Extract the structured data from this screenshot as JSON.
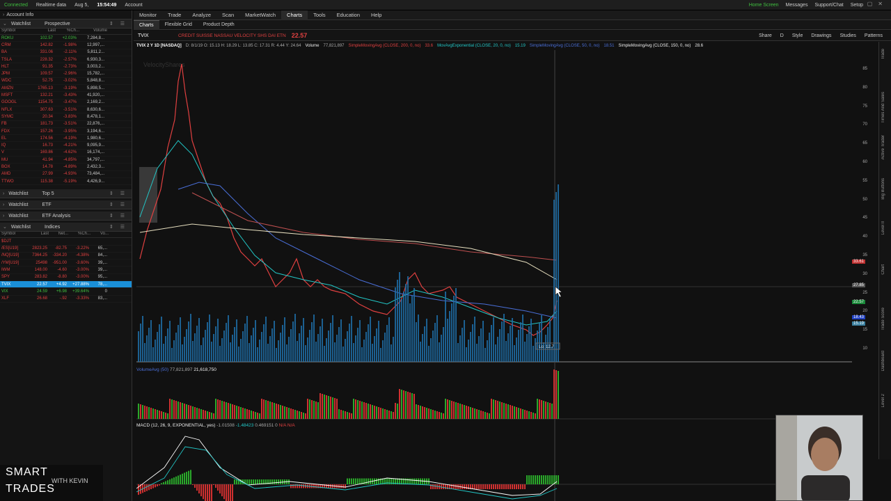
{
  "titlebar": {
    "status": "Connected",
    "realtime": "Realtime data",
    "date": "Aug 5,",
    "time": "15:54:49",
    "account": "Account",
    "home": "Home Screen",
    "messages": "Messages",
    "support": "Support/Chat",
    "setup": "Setup"
  },
  "left": {
    "account_info": "Account Info",
    "watchlist1": {
      "label": "Watchlist",
      "name": "Prospective",
      "cols": [
        "Symbol",
        "Last",
        "%Ch...",
        "Volume"
      ],
      "rows": [
        {
          "sym": "ROKU",
          "last": "102.57",
          "chg": "+2.03%",
          "vol": "7,284,8...",
          "up": true
        },
        {
          "sym": "CRM",
          "last": "142.82",
          "chg": "-1.98%",
          "vol": "12,997,..."
        },
        {
          "sym": "BA",
          "last": "331.06",
          "chg": "-2.11%",
          "vol": "5,811,2..."
        },
        {
          "sym": "TSLA",
          "last": "228.32",
          "chg": "-2.57%",
          "vol": "6,930,3..."
        },
        {
          "sym": "HLT",
          "last": "91.35",
          "chg": "-2.73%",
          "vol": "3,003,2..."
        },
        {
          "sym": "JPM",
          "last": "109.57",
          "chg": "-2.96%",
          "vol": "15,782,..."
        },
        {
          "sym": "WDC",
          "last": "52.75",
          "chg": "-3.02%",
          "vol": "5,848,8..."
        },
        {
          "sym": "AMZN",
          "last": "1765.13",
          "chg": "-3.19%",
          "vol": "5,898,5..."
        },
        {
          "sym": "MSFT",
          "last": "132.21",
          "chg": "-3.43%",
          "vol": "41,920,..."
        },
        {
          "sym": "GOOGL",
          "last": "1154.75",
          "chg": "-3.47%",
          "vol": "2,169,2..."
        },
        {
          "sym": "NFLX",
          "last": "307.63",
          "chg": "-3.51%",
          "vol": "8,630,6..."
        },
        {
          "sym": "SYMC",
          "last": "20.34",
          "chg": "-3.83%",
          "vol": "8,478,1..."
        },
        {
          "sym": "FB",
          "last": "181.73",
          "chg": "-3.51%",
          "vol": "22,876,..."
        },
        {
          "sym": "FDX",
          "last": "157.26",
          "chg": "-3.95%",
          "vol": "3,194,6..."
        },
        {
          "sym": "EL",
          "last": "174.56",
          "chg": "-4.19%",
          "vol": "1,980,6..."
        },
        {
          "sym": "IQ",
          "last": "16.73",
          "chg": "-4.21%",
          "vol": "9,095,9..."
        },
        {
          "sym": "V",
          "last": "169.86",
          "chg": "-4.62%",
          "vol": "16,174,..."
        },
        {
          "sym": "MU",
          "last": "41.94",
          "chg": "-4.85%",
          "vol": "34,797,..."
        },
        {
          "sym": "BOX",
          "last": "14.78",
          "chg": "-4.89%",
          "vol": "2,432,3..."
        },
        {
          "sym": "AMD",
          "last": "27.99",
          "chg": "-4.93%",
          "vol": "73,484,..."
        },
        {
          "sym": "TTWO",
          "last": "115.38",
          "chg": "-5.19%",
          "vol": "4,426,9..."
        }
      ]
    },
    "watchlist2": {
      "label": "Watchlist",
      "name": "Top 5"
    },
    "watchlist3": {
      "label": "Watchlist",
      "name": "ETF"
    },
    "watchlist4": {
      "label": "Watchlist",
      "name": "ETF Analysis"
    },
    "watchlist5": {
      "label": "Watchlist",
      "name": "Indices",
      "cols": [
        "Symbol",
        "Last",
        "Net...",
        "%Ch...",
        "Vo..."
      ],
      "rows": [
        {
          "sym": "$DJT",
          "last": "",
          "net": "",
          "chg": "",
          "vol": ""
        },
        {
          "sym": "/ES[U19]",
          "last": "2823.25",
          "net": "-82.75",
          "chg": "-3.22%",
          "vol": "65,..."
        },
        {
          "sym": "/NQ[U19]",
          "last": "7364.25",
          "net": "-334.20",
          "chg": "-4.38%",
          "vol": "84,..."
        },
        {
          "sym": "/YM[U19]",
          "last": "25498",
          "net": "-951.00",
          "chg": "-3.60%",
          "vol": "39,..."
        },
        {
          "sym": "IWM",
          "last": "148.00",
          "net": "-4.60",
          "chg": "-3.00%",
          "vol": "39,..."
        },
        {
          "sym": "SPY",
          "last": "283.82",
          "net": "-8.80",
          "chg": "-3.00%",
          "vol": "95,..."
        },
        {
          "sym": "TVIX",
          "last": "22.57",
          "net": "+4.92",
          "chg": "+27.88%",
          "vol": "78,...",
          "sel": true
        },
        {
          "sym": "VIX",
          "last": "24.59",
          "net": "+6.98",
          "chg": "+39.64%",
          "vol": "0",
          "up": true
        },
        {
          "sym": "XLF",
          "last": "26.68",
          "net": "-.92",
          "chg": "-3.33%",
          "vol": "83,..."
        }
      ]
    }
  },
  "topnav": {
    "tabs": [
      "Monitor",
      "Trade",
      "Analyze",
      "Scan",
      "MarketWatch",
      "Charts",
      "Tools",
      "Education",
      "Help"
    ],
    "active": "Charts"
  },
  "subnav": {
    "tabs": [
      "Charts",
      "Flexible Grid",
      "Product Depth"
    ]
  },
  "symbar": {
    "symbol": "TVIX",
    "description": "CREDIT SUISSE NASSAU VELOCITY SHS DAI ETN",
    "price": "22.57",
    "buttons": [
      "Share",
      "D",
      "Style",
      "Drawings",
      "Studies",
      "Patterns"
    ]
  },
  "charthdr": {
    "label": "TVIX 2 Y 1D [NASDAQ]",
    "ohlc": "D: 8/1/19   O: 15.13   H: 18.29   L: 13.85   C: 17.31   R: 4.44   Y: 24.64",
    "volume_label": "Volume",
    "volume_value": "77,821,897",
    "sma200": "SimpleMovingAvg (CLOSE, 200, 0, no)",
    "sma200_val": "33.6",
    "ema20": "MovAvgExponential (CLOSE, 20, 0, no)",
    "ema20_val": "15.19",
    "sma50": "SimpleMovingAvg (CLOSE, 50, 0, no)",
    "sma50_val": "18.51",
    "sma150": "SimpleMovingAvg (CLOSE, 150, 0, no)",
    "sma150_val": "28.6"
  },
  "watermark": "VelocityShares",
  "low_label": "Lo: 12.7",
  "axis_ticks": [
    "85",
    "80",
    "75",
    "70",
    "65",
    "60",
    "55",
    "50",
    "45",
    "40",
    "35",
    "30",
    "25",
    "20",
    "15",
    "10"
  ],
  "price_badges": {
    "sma200": "33.61",
    "ema": "27.85",
    "last": "22.57",
    "sma50": "18.43",
    "ema20": "15.19"
  },
  "volume_panel": {
    "label": "VolumeAvg (50)",
    "v1": "77,821,897",
    "v2": "21,618,750"
  },
  "macd_panel": {
    "label": "MACD (12, 26, 9, EXPONENTIAL, yes)",
    "v1": "-1.01508",
    "v2": "-1.48423",
    "v3": "0.469151",
    "v4": "0",
    "v5": "N/A",
    "v6": "N/A"
  },
  "right_strip": [
    "Trade",
    "Times And Sales",
    "Active Trader",
    "Big Buttons",
    "Level II",
    "Chart",
    "Trade Score",
    "Dashboard",
    "Level 2"
  ],
  "brand": {
    "line1": "SMART",
    "line2": "TRADES",
    "line3": "WITH KEVIN"
  },
  "colors": {
    "bg": "#111111",
    "up": "#3fbf3f",
    "down": "#e04040",
    "ema": "#22c7c7",
    "sma50": "#4a6fd8",
    "sma200": "#c05050",
    "sma150": "#e8e0c0",
    "volume": "#1f6fa8"
  }
}
